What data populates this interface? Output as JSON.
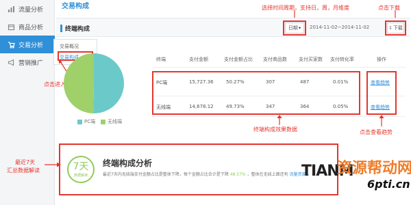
{
  "page_title": "交易构成",
  "sidebar": {
    "items": [
      {
        "label": "流量分析",
        "icon": "chart-icon"
      },
      {
        "label": "商品分析",
        "icon": "box-icon"
      },
      {
        "label": "交易分析",
        "icon": "cart-icon"
      },
      {
        "label": "营销推广",
        "icon": "megaphone-icon"
      }
    ],
    "active_index": 2,
    "submenu": [
      "交易概况",
      "交易构成"
    ]
  },
  "section": {
    "title": "终端构成",
    "date_select": "日期",
    "date_range": "2014-11-02~2014-11-02",
    "download_label": "下载"
  },
  "annotations": {
    "top_date": "选择时间周期，支持日，周，月维度",
    "top_download": "点击下载",
    "click_enter": "点击进入",
    "terminal_data": "终端构成效果数据",
    "view_trend": "点击查看趋势",
    "recent_7_l1": "最近7天",
    "recent_7_l2": "汇总数据解读"
  },
  "table": {
    "headers": [
      "终端",
      "支付金额",
      "支付金额占比",
      "支付商品数",
      "支付买家数",
      "支付转化率",
      "操作"
    ],
    "rows": [
      {
        "terminal": "PC端",
        "amount": "15,727.36",
        "amount_pct": "50.27%",
        "items": "307",
        "buyers": "487",
        "conversion": "0.01%",
        "action": "查看趋势"
      },
      {
        "terminal": "无线端",
        "amount": "14,678.12",
        "amount_pct": "49.73%",
        "items": "347",
        "buyers": "364",
        "conversion": "0.05%",
        "action": "查看趋势"
      }
    ]
  },
  "legend": [
    {
      "label": "PC端",
      "color": "#6cc9c9"
    },
    {
      "label": "无线端",
      "color": "#9fd06a"
    }
  ],
  "summary": {
    "badge_number": "7天",
    "badge_label": "数据解读",
    "title": "终端构成分析",
    "text_prefix": "最近7天内无线端支付金额占比是整体下降，每个金额占比合计是下降",
    "text_pct": "48.57%",
    "text_suffix": "，整体在无线上面还有",
    "text_link": "流量资源",
    "text_end": "，"
  },
  "watermark": {
    "latin": "TIANM",
    "cn": "资源帮动网",
    "url": "6pti.cn"
  },
  "colors": {
    "accent": "#2f8fd8",
    "annotation_red": "#e5352c",
    "pc": "#6cc9c9",
    "wireless": "#9fd06a"
  }
}
